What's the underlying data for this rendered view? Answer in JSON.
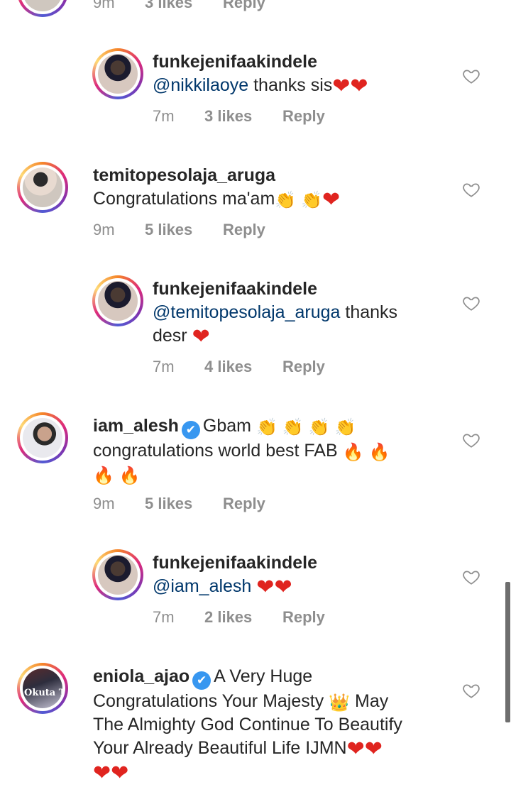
{
  "icons": {
    "like": "heart-outline-icon",
    "verified": "verified-badge-icon",
    "clap": "👏",
    "heart": "❤",
    "fire": "🔥",
    "crown": "👑"
  },
  "colors": {
    "mention": "#00376b",
    "meta": "#8e8e8e",
    "heart": "#e0241f",
    "verified": "#3897f0"
  },
  "top_partial": {
    "time": "9m",
    "likes": "3 likes",
    "reply": "Reply"
  },
  "comments": [
    {
      "username": "funkejenifaakindele",
      "mention": "@nikkilaoye",
      "text": " thanks sis",
      "time": "7m",
      "likes": "3 likes",
      "reply": "Reply"
    },
    {
      "username": "temitopesolaja_aruga",
      "text": "Congratulations ma'am",
      "time": "9m",
      "likes": "5 likes",
      "reply": "Reply"
    },
    {
      "username": "funkejenifaakindele",
      "mention": "@temitopesolaja_aruga",
      "text": " thanks",
      "text2": "desr",
      "time": "7m",
      "likes": "4 likes",
      "reply": "Reply"
    },
    {
      "username": "iam_alesh",
      "text": "Gbam",
      "text2": "congratulations world best FAB",
      "time": "9m",
      "likes": "5 likes",
      "reply": "Reply"
    },
    {
      "username": "funkejenifaakindele",
      "mention": "@iam_alesh",
      "time": "7m",
      "likes": "2 likes",
      "reply": "Reply"
    },
    {
      "username": "eniola_ajao",
      "text": "A Very Huge",
      "text2": "Congratulations Your Majesty",
      "text2b": " May",
      "text3": "The Almighty God Continue To Beautify",
      "text4": "Your Already Beautiful Life IJMN",
      "avatar_overlay": "Okuta Ti"
    }
  ]
}
